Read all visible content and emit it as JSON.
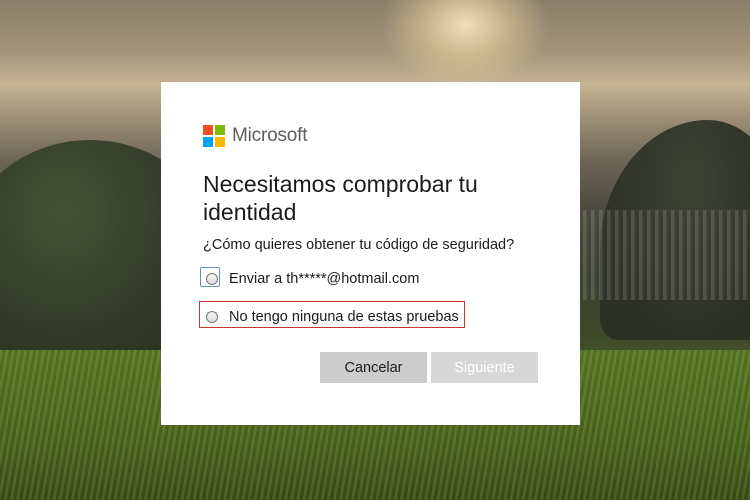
{
  "brand": {
    "name": "Microsoft",
    "logo_colors": [
      "#f25022",
      "#7fba00",
      "#00a4ef",
      "#ffb900"
    ]
  },
  "dialog": {
    "title": "Necesitamos comprobar tu identidad",
    "question": "¿Cómo quieres obtener tu código de seguridad?",
    "options": [
      {
        "label": "Enviar a th*****@hotmail.com",
        "selected": false,
        "focused": true
      },
      {
        "label": "No tengo ninguna de estas pruebas",
        "selected": false,
        "highlighted": true
      }
    ],
    "buttons": {
      "cancel": "Cancelar",
      "next": "Siguiente",
      "next_enabled": false
    }
  },
  "colors": {
    "highlight_border": "#c8332b",
    "focus_border": "#6a8cc8",
    "button_bg": "#cccccc"
  }
}
